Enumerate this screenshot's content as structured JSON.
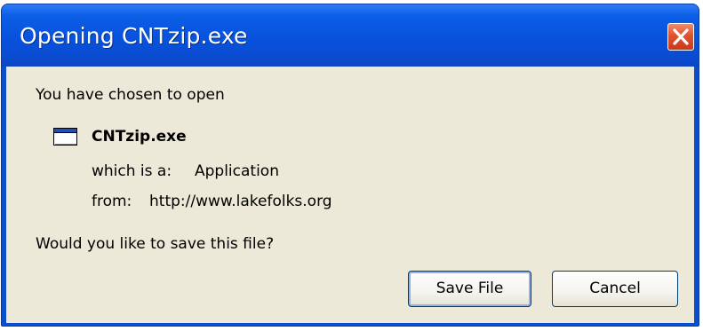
{
  "dialog": {
    "title": "Opening CNTzip.exe",
    "intro": "You have chosen to open",
    "file_name": "CNTzip.exe",
    "type_label": "which is a:",
    "type_value": "Application",
    "from_label": "from:",
    "from_value": "http://www.lakefolks.org",
    "question": "Would you like to save this file?",
    "buttons": {
      "save": "Save File",
      "cancel": "Cancel"
    }
  },
  "icons": {
    "close": "close-icon",
    "file": "application-window-icon"
  },
  "colors": {
    "titlebar": "#0852dd",
    "close_button": "#e0532f",
    "dialog_body": "#ece9d8",
    "button_border": "#003c74"
  }
}
